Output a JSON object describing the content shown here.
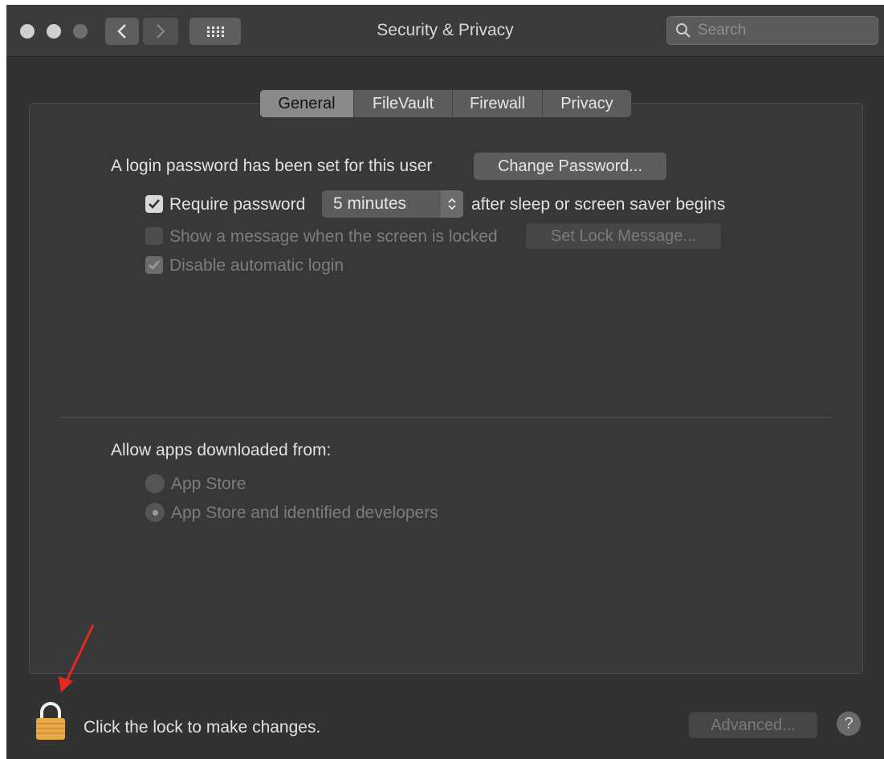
{
  "window": {
    "title": "Security & Privacy",
    "search_placeholder": "Search",
    "back_icon": "chevron-left-icon",
    "forward_icon": "chevron-right-icon",
    "grid_icon": "grid-icon"
  },
  "tabs": [
    {
      "label": "General",
      "active": true
    },
    {
      "label": "FileVault",
      "active": false
    },
    {
      "label": "Firewall",
      "active": false
    },
    {
      "label": "Privacy",
      "active": false
    }
  ],
  "general": {
    "login_password_text": "A login password has been set for this user",
    "change_password_label": "Change Password...",
    "require_password_label": "Require password",
    "require_password_checked": true,
    "require_password_delay": "5 minutes",
    "after_sleep_text": "after sleep or screen saver begins",
    "show_message_label": "Show a message when the screen is locked",
    "show_message_checked": false,
    "set_lock_message_label": "Set Lock Message...",
    "disable_auto_login_label": "Disable automatic login",
    "disable_auto_login_checked": true
  },
  "allow_apps": {
    "heading": "Allow apps downloaded from:",
    "options": [
      {
        "label": "App Store",
        "selected": false
      },
      {
        "label": "App Store and identified developers",
        "selected": true
      }
    ]
  },
  "footer": {
    "lock_text": "Click the lock to make changes.",
    "advanced_label": "Advanced...",
    "help_label": "?"
  },
  "colors": {
    "annotation_arrow": "#e8281e",
    "lock_body": "#e9a94a"
  }
}
